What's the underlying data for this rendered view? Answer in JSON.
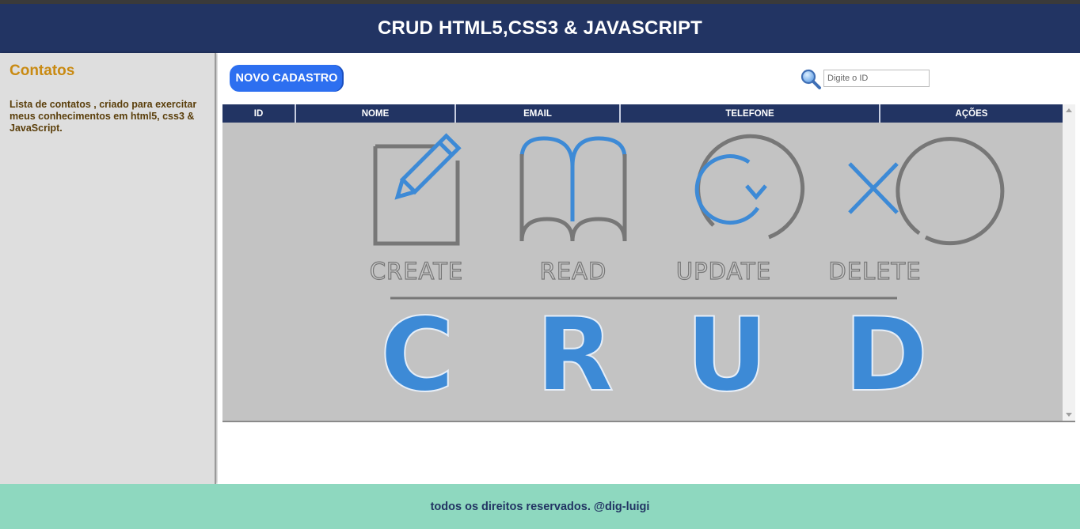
{
  "header": {
    "title": "CRUD HTML5,CSS3 & JAVASCRIPT"
  },
  "sidebar": {
    "title": "Contatos",
    "description": "Lista de contatos , criado para exercitar meus conhecimentos em html5, css3 & JavaScript."
  },
  "toolbar": {
    "new_button_label": "NOVO CADASTRO",
    "search_icon": "search-icon",
    "search_placeholder": "Digite o ID"
  },
  "table": {
    "columns": [
      "ID",
      "NOME",
      "EMAIL",
      "TELEFONE",
      "AÇÕES"
    ]
  },
  "banner": {
    "words": [
      "CREATE",
      "READ",
      "UPDATE",
      "DELETE"
    ],
    "letters": [
      "C",
      "R",
      "U",
      "D"
    ],
    "colors": {
      "accent": "#3d8ad6",
      "outline": "#777777",
      "background": "#c3c3c3"
    }
  },
  "footer": {
    "text": "todos os direitos reservados. @dig-luigi"
  },
  "colors": {
    "header": "#223463",
    "sidebar_title": "#c98a12",
    "button": "#2d6ff0",
    "footer": "#8ed8bf"
  }
}
